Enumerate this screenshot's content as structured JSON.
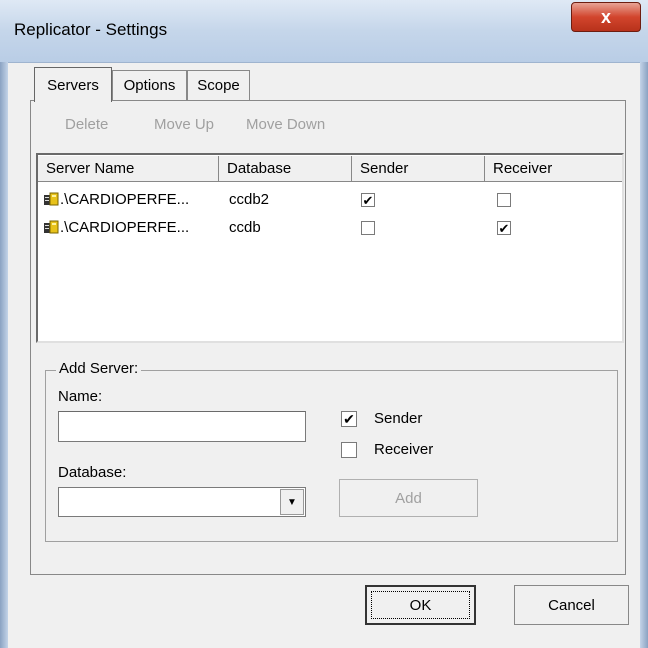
{
  "window": {
    "title": "Replicator - Settings",
    "close_glyph": "x"
  },
  "tabs": [
    {
      "label": "Servers",
      "active": true
    },
    {
      "label": "Options",
      "active": false
    },
    {
      "label": "Scope",
      "active": false
    }
  ],
  "toolbar": {
    "delete": "Delete",
    "move_up": "Move Up",
    "move_down": "Move Down"
  },
  "table": {
    "columns": [
      "Server Name",
      "Database",
      "Sender",
      "Receiver"
    ],
    "rows": [
      {
        "server": ".\\CARDIOPERFE...",
        "database": "ccdb2",
        "sender": true,
        "receiver": false
      },
      {
        "server": ".\\CARDIOPERFE...",
        "database": "ccdb",
        "sender": false,
        "receiver": true
      }
    ]
  },
  "add_server": {
    "group_label": "Add Server:",
    "name_label": "Name:",
    "name_value": "",
    "database_label": "Database:",
    "database_value": "",
    "sender_label": "Sender",
    "sender_checked": true,
    "receiver_label": "Receiver",
    "receiver_checked": false,
    "add_label": "Add"
  },
  "buttons": {
    "ok": "OK",
    "cancel": "Cancel"
  },
  "icons": {
    "check": "✔",
    "dropdown": "▼",
    "server": "server-icon"
  }
}
